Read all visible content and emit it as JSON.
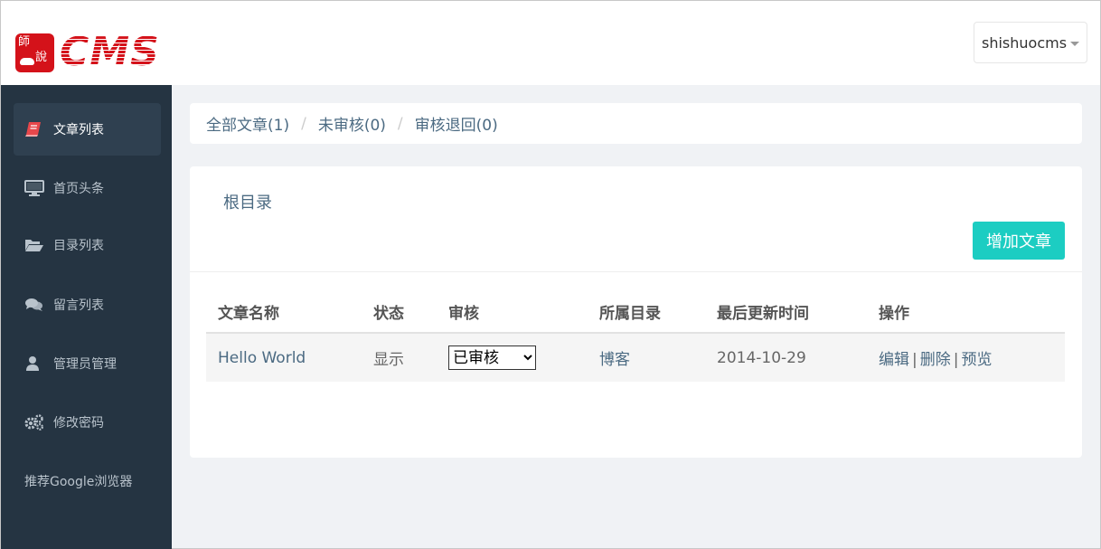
{
  "header": {
    "logo_seal_chars": [
      "師",
      "說"
    ],
    "logo_text": "CMS",
    "user_name": "shishuocms"
  },
  "sidebar": {
    "items": [
      {
        "label": "文章列表",
        "icon": "book-icon",
        "active": true
      },
      {
        "label": "首页头条",
        "icon": "monitor-icon",
        "active": false
      },
      {
        "label": "目录列表",
        "icon": "folder-open-icon",
        "active": false
      },
      {
        "label": "留言列表",
        "icon": "comments-icon",
        "active": false
      },
      {
        "label": "管理员管理",
        "icon": "user-icon",
        "active": false
      },
      {
        "label": "修改密码",
        "icon": "gears-icon",
        "active": false
      },
      {
        "label": "推荐Google浏览器",
        "icon": "",
        "active": false
      }
    ]
  },
  "breadcrumb": {
    "items": [
      "全部文章(1)",
      "未审核(0)",
      "审核退回(0)"
    ],
    "separator": "/"
  },
  "content": {
    "title": "根目录",
    "add_button": "增加文章",
    "table": {
      "headers": [
        "文章名称",
        "状态",
        "审核",
        "所属目录",
        "最后更新时间",
        "操作"
      ],
      "rows": [
        {
          "name": "Hello World",
          "status": "显示",
          "review": "已审核",
          "category": "博客",
          "updated": "2014-10-29",
          "actions": [
            "编辑",
            "删除",
            "预览"
          ]
        }
      ]
    }
  },
  "colors": {
    "sidebar_bg": "#253442",
    "accent": "#1ccdc2",
    "link": "#4b6a82",
    "brand_red": "#d4121a"
  }
}
